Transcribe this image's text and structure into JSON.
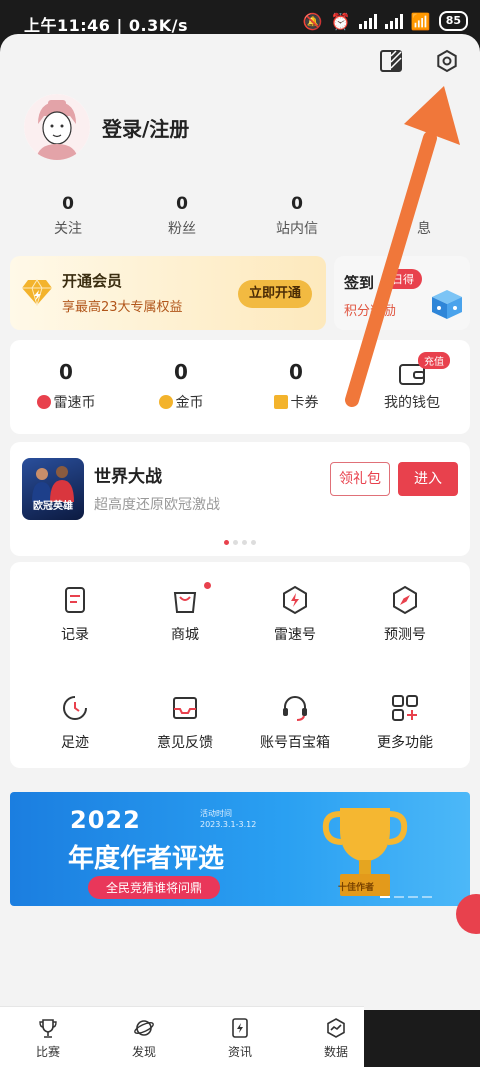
{
  "status_bar": {
    "time_speed": "上午11:46 | 0.3K/s",
    "battery": "85"
  },
  "profile": {
    "login_label": "登录/注册"
  },
  "stats": [
    {
      "value": "0",
      "label": "关注"
    },
    {
      "value": "0",
      "label": "粉丝"
    },
    {
      "value": "0",
      "label": "站内信"
    },
    {
      "value": "",
      "label": "息"
    }
  ],
  "vip": {
    "title": "开通会员",
    "subtitle": "享最高23大专属权益",
    "button": "立即开通"
  },
  "checkin": {
    "title": "签到",
    "badge": "日得",
    "subtitle": "积分奖励"
  },
  "wallet": {
    "items": [
      {
        "value": "0",
        "label": "雷速币",
        "color": "#e8414d"
      },
      {
        "value": "0",
        "label": "金币",
        "color": "#f3b32c"
      },
      {
        "value": "0",
        "label": "卡券",
        "color": "#f3b32c"
      }
    ],
    "my_wallet": "我的钱包",
    "charge_badge": "充值"
  },
  "game": {
    "thumb_text": "欧冠英雄",
    "name": "世界大战",
    "description": "超高度还原欧冠激战",
    "gift_button": "领礼包",
    "enter_button": "进入"
  },
  "functions": [
    {
      "label": "记录",
      "icon": "record-icon"
    },
    {
      "label": "商城",
      "icon": "shop-bag-icon"
    },
    {
      "label": "雷速号",
      "icon": "leisu-hexagon-icon"
    },
    {
      "label": "预测号",
      "icon": "compass-hexagon-icon"
    },
    {
      "label": "足迹",
      "icon": "history-clock-icon"
    },
    {
      "label": "意见反馈",
      "icon": "feedback-inbox-icon"
    },
    {
      "label": "账号百宝箱",
      "icon": "headset-icon"
    },
    {
      "label": "更多功能",
      "icon": "grid-plus-icon"
    }
  ],
  "banner": {
    "year": "2022",
    "time_label": "活动时间",
    "time_range": "2023.3.1-3.12",
    "title": "年度作者评选",
    "pill": "全民竞猜谁将问鼎",
    "trophy_label": "十佳作者"
  },
  "tabbar": [
    {
      "label": "比赛",
      "icon": "trophy-icon"
    },
    {
      "label": "发现",
      "icon": "planet-icon"
    },
    {
      "label": "资讯",
      "icon": "news-bolt-icon"
    },
    {
      "label": "数据",
      "icon": "data-chart-icon"
    }
  ],
  "colors": {
    "accent_red": "#e8414d",
    "gold": "#f2ba41",
    "arrow_orange": "#f0773a"
  }
}
